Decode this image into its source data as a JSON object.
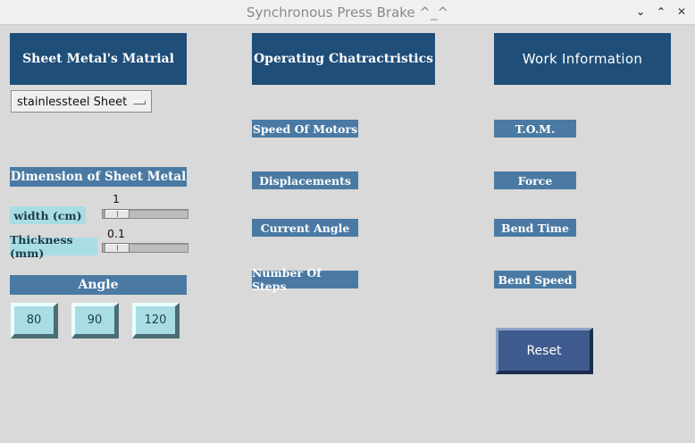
{
  "window": {
    "title": "Synchronous Press Brake ^_^",
    "buttons": {
      "minimize": "⌄",
      "maximize": "⌃",
      "close": "✕"
    }
  },
  "left": {
    "header": "Sheet Metal's Matrial",
    "dropdown_value": "stainlessteel Sheet",
    "dimension_header": "Dimension of Sheet Metal",
    "width_label": "width (cm)",
    "width_value": "1",
    "thickness_label": "Thickness (mm)",
    "thickness_value": "0.1",
    "angle_header": "Angle",
    "angle_buttons": [
      "80",
      "90",
      "120"
    ]
  },
  "middle": {
    "header": "Operating Chatractristics",
    "labels": [
      "Speed Of Motors",
      "Displacements",
      "Current Angle",
      "Number Of Steps"
    ]
  },
  "right": {
    "header": "Work Information",
    "labels": [
      "T.O.M.",
      "Force",
      "Bend Time",
      "Bend Speed"
    ],
    "reset_label": "Reset"
  },
  "colors": {
    "header_bg": "#1f4e79",
    "label_bg": "#4a7aa3",
    "light_label_bg": "#a8dde4",
    "reset_bg": "#3f5a8e",
    "window_bg": "#d9d9d9"
  }
}
